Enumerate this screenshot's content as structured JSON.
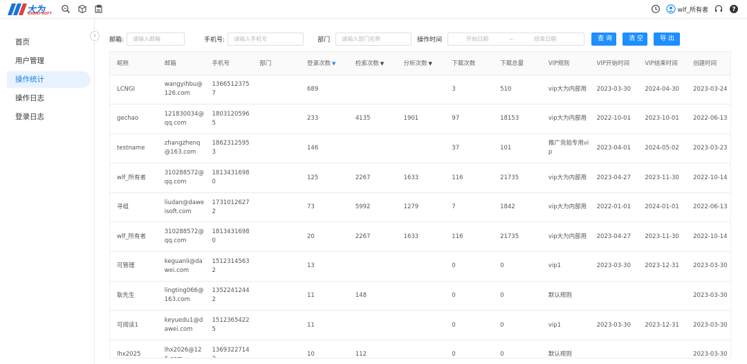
{
  "app": {
    "logo_text": "大为",
    "logo_sub": "DAWEI SOFT"
  },
  "topbar": {
    "user_name": "wlf_所有者",
    "icons": [
      "zoom-icon",
      "cube-icon",
      "export-icon",
      "clock-icon",
      "user-icon",
      "headset-icon",
      "help-icon"
    ]
  },
  "sidebar": {
    "collapse": "‹",
    "items": [
      {
        "label": "首页"
      },
      {
        "label": "用户管理"
      },
      {
        "label": "操作统计"
      },
      {
        "label": "操作日志"
      },
      {
        "label": "登录日志"
      }
    ]
  },
  "filters": {
    "email_label": "邮箱:",
    "email_placeholder": "请输入邮箱",
    "phone_label": "手机号:",
    "phone_placeholder": "请输入手机号",
    "dept_label": "部门",
    "dept_placeholder": "请输入部门名称",
    "time_label": "操作时间",
    "start_placeholder": "开始日期",
    "range_sep": "~",
    "end_placeholder": "结束日期",
    "query_btn": "查 询",
    "clear_btn": "清 空",
    "export_btn": "导 出"
  },
  "table": {
    "headers": [
      "昵称",
      "邮箱",
      "手机号",
      "部门",
      "登录次数",
      "检索次数",
      "分析次数",
      "下载次数",
      "下载总量",
      "VIP规则",
      "VIP开始时间",
      "VIP结束时间",
      "创建时间"
    ],
    "sort_marks": {
      "login": "▼",
      "search": "▼",
      "analysis": "▼"
    },
    "rows": [
      [
        "LCNGI",
        "wangyihbu@126.com",
        "13665123757",
        "",
        "689",
        "",
        "",
        "3",
        "510",
        "vip大为内部用",
        "2023-03-30",
        "2024-04-30",
        "2023-03-24"
      ],
      [
        "gechao",
        "121830034@qq.com",
        "18031205965",
        "",
        "233",
        "4135",
        "1901",
        "97",
        "18153",
        "vip大为内部用",
        "2022-10-01",
        "2023-10-01",
        "2022-06-13"
      ],
      [
        "testname",
        "zhangzhenq@163.com",
        "18623125953",
        "",
        "146",
        "",
        "",
        "37",
        "101",
        "推广竞拍专用vip",
        "2023-04-01",
        "2024-05-02",
        "2023-03-23"
      ],
      [
        "wlf_所有者",
        "310288572@qq.com",
        "18134316980",
        "",
        "125",
        "2267",
        "1633",
        "116",
        "21735",
        "vip大为内部用",
        "2023-04-27",
        "2023-11-30",
        "2022-10-14"
      ],
      [
        "寻组",
        "liudan@daweisoft.com",
        "17310126272",
        "",
        "73",
        "5992",
        "1279",
        "7",
        "1842",
        "vip大为内部用",
        "2022-01-01",
        "2024-01-01",
        "2022-06-13"
      ],
      [
        "wlf_所有者",
        "310288572@qq.com",
        "18134316980",
        "",
        "20",
        "2267",
        "1633",
        "116",
        "21735",
        "vip大为内部用",
        "2023-04-27",
        "2023-11-30",
        "2022-10-14"
      ],
      [
        "可管理",
        "keguanli@dawei.com",
        "15123145632",
        "",
        "13",
        "",
        "",
        "0",
        "0",
        "vip1",
        "2023-03-30",
        "2023-12-31",
        "2023-03-30"
      ],
      [
        "耿先生",
        "lingting066@163.com",
        "13522412442",
        "",
        "11",
        "148",
        "",
        "0",
        "0",
        "默认规则",
        "",
        "",
        "2023-03-30"
      ],
      [
        "可阅读1",
        "keyuedu1@dawei.com",
        "15123654225",
        "",
        "11",
        "",
        "",
        "0",
        "0",
        "vip1",
        "2023-03-30",
        "2023-12-31",
        "2023-03-30"
      ],
      [
        "lhx2025",
        "lhx2026@126.com",
        "13693227142",
        "",
        "10",
        "112",
        "",
        "0",
        "0",
        "默认规则",
        "",
        "",
        "2023-03-30"
      ]
    ]
  }
}
